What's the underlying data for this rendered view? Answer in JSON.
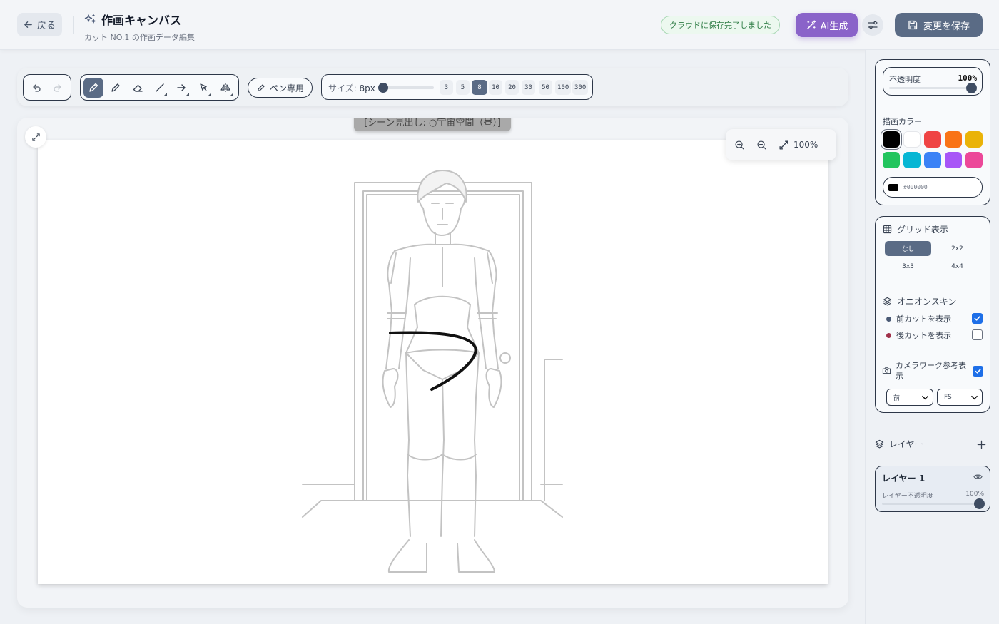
{
  "header": {
    "back_label": "戻る",
    "title": "作画キャンバス",
    "subtitle": "カット NO.1 の作画データ編集",
    "save_status": "クラウドに保存完了しました",
    "ai_label": "AI生成",
    "save_label": "変更を保存"
  },
  "toolbar": {
    "history": [
      "undo-icon",
      "redo-icon"
    ],
    "tools": [
      "pen-icon",
      "pencil-icon",
      "eraser-icon",
      "line-icon",
      "arrow-icon",
      "select-icon",
      "flip-icon"
    ],
    "active_tool": "pen",
    "pen_only_label": "ペン専用",
    "size_label": "サイズ:",
    "size_value": "8px",
    "size_presets": [
      "3",
      "5",
      "8",
      "10",
      "20",
      "30",
      "50",
      "100",
      "300"
    ],
    "active_size": "8"
  },
  "canvas": {
    "scene_label": "[シーン見出し: ○宇宙空間（昼）]",
    "zoom_level": "100%"
  },
  "sidebar": {
    "opacity_label": "不透明度",
    "opacity_value": "100%",
    "color_label": "描画カラー",
    "colors": [
      "#000000",
      "#ffffff",
      "#ef4444",
      "#f97316",
      "#eab308",
      "#22c55e",
      "#06b6d4",
      "#3b82f6",
      "#a855f7",
      "#ec4899"
    ],
    "selected_color": "#000000",
    "hex_value": "#000000",
    "grid": {
      "label": "グリッド表示",
      "options": [
        "なし",
        "2x2",
        "3x3",
        "4x4"
      ],
      "selected": "なし"
    },
    "onion": {
      "label": "オニオンスキン",
      "prev_label": "前カットを表示",
      "prev_checked": true,
      "prev_color": "#4a5a75",
      "next_label": "後カットを表示",
      "next_checked": false,
      "next_color": "#a0304a"
    },
    "camera": {
      "label": "カメラワーク参考表示",
      "checked": true,
      "select1": "前",
      "select2": "FS"
    },
    "layers": {
      "label": "レイヤー",
      "items": [
        {
          "name": "レイヤー 1",
          "opacity_label": "レイヤー不透明度",
          "opacity_value": "100%"
        }
      ]
    }
  }
}
